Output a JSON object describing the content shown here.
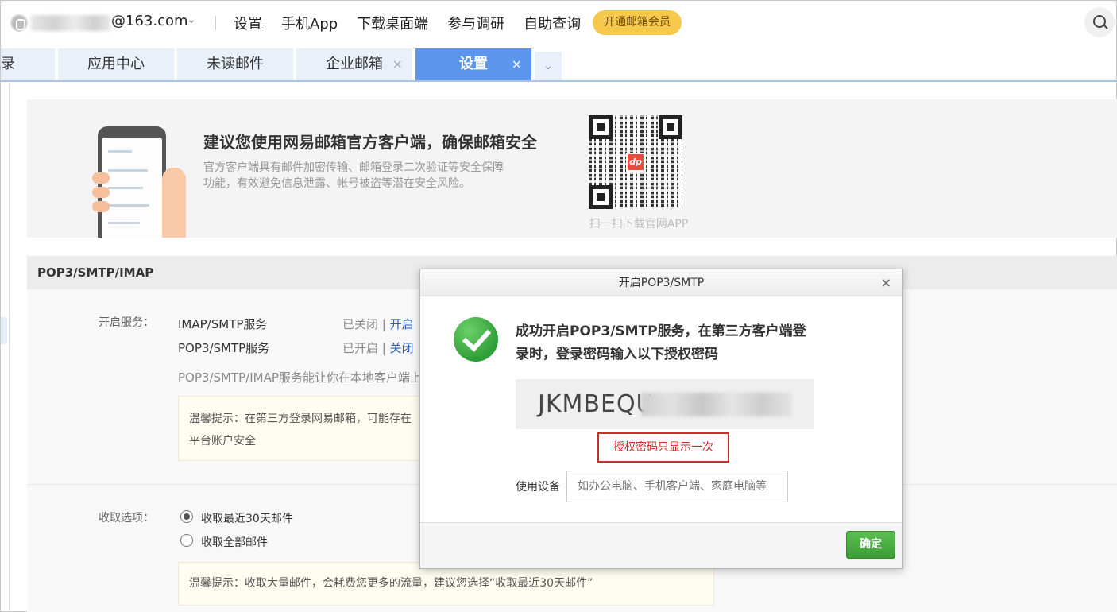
{
  "account": {
    "email_suffix": "@163.com",
    "chevron": "⌄"
  },
  "top_nav": {
    "items": [
      "设置",
      "手机App",
      "下载桌面端",
      "参与调研",
      "自助查询"
    ],
    "vip_label": "开通邮箱会员"
  },
  "tabs": {
    "items": [
      {
        "label": "录"
      },
      {
        "label": "应用中心"
      },
      {
        "label": "未读邮件"
      },
      {
        "label": "企业邮箱",
        "close": "×"
      },
      {
        "label": "设置",
        "close": "×"
      }
    ],
    "more": "⌄"
  },
  "banner": {
    "title": "建议您使用网易邮箱官方客户端，确保邮箱安全",
    "desc": "官方客户端具有邮件加密传输、邮箱登录二次验证等安全保障功能，有效避免信息泄露、帐号被盗等潜在安全风险。",
    "qr_caption": "扫一扫下载官网APP"
  },
  "section": {
    "title": "POP3/SMTP/IMAP",
    "service_label": "开启服务：",
    "services": [
      {
        "name": "IMAP/SMTP服务",
        "state": "已关闭",
        "sep": " | ",
        "action": "开启"
      },
      {
        "name": "POP3/SMTP服务",
        "state": "已开启",
        "sep": " | ",
        "action": "关闭"
      }
    ],
    "service_desc": "POP3/SMTP/IMAP服务能让你在本地客户端上",
    "tip1_line1": "温馨提示：在第三方登录网易邮箱，可能存在",
    "tip1_line2": "平台账户安全",
    "receive_label": "收取选项：",
    "options": [
      "收取最近30天邮件",
      "收取全部邮件"
    ],
    "tip2": "温馨提示：收取大量邮件，会耗费您更多的流量，建议您选择“收取最近30天邮件”"
  },
  "modal": {
    "title": "开启POP3/SMTP",
    "close": "×",
    "success_line1": "成功开启POP3/SMTP服务，在第三方客户端登",
    "success_line2": "录时，登录密码输入以下授权密码",
    "code_visible": "JKMBEQU",
    "once_note": "授权密码只显示一次",
    "device_label": "使用设备",
    "device_placeholder": "如办公电脑、手机客户端、家庭电脑等",
    "ok_label": "确定"
  }
}
